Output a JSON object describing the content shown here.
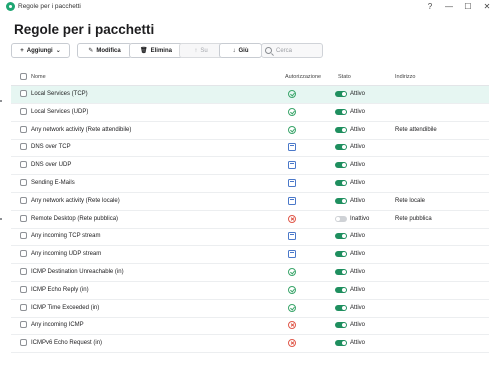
{
  "window": {
    "title": "Regole per i pacchetti",
    "help": "?",
    "minimize": "—",
    "maximize": "☐",
    "close": "✕"
  },
  "page": {
    "heading": "Regole per i pacchetti"
  },
  "toolbar": {
    "add_label": "Aggiungi",
    "edit_label": "Modifica",
    "delete_label": "Elimina",
    "up_label": "Su",
    "down_label": "Giù"
  },
  "search": {
    "placeholder": "Cerca"
  },
  "columns": {
    "name": "Nome",
    "auth": "Autorizzazione",
    "status": "Stato",
    "address": "Indirizzo"
  },
  "rows": [
    {
      "name": "Local Services (TCP)",
      "auth": "allow",
      "on": true,
      "status": "Attivo",
      "address": ""
    },
    {
      "name": "Local Services (UDP)",
      "auth": "allow",
      "on": true,
      "status": "Attivo",
      "address": ""
    },
    {
      "name": "Any network activity (Rete attendibile)",
      "auth": "allow",
      "on": true,
      "status": "Attivo",
      "address": "Rete attendibile"
    },
    {
      "name": "DNS over TCP",
      "auth": "ask",
      "on": true,
      "status": "Attivo",
      "address": ""
    },
    {
      "name": "DNS over UDP",
      "auth": "ask",
      "on": true,
      "status": "Attivo",
      "address": ""
    },
    {
      "name": "Sending E-Mails",
      "auth": "ask",
      "on": true,
      "status": "Attivo",
      "address": ""
    },
    {
      "name": "Any network activity (Rete locale)",
      "auth": "ask",
      "on": true,
      "status": "Attivo",
      "address": "Rete locale"
    },
    {
      "name": "Remote Desktop (Rete pubblica)",
      "auth": "block",
      "on": false,
      "status": "Inattivo",
      "address": "Rete pubblica"
    },
    {
      "name": "Any incoming TCP stream",
      "auth": "ask",
      "on": true,
      "status": "Attivo",
      "address": ""
    },
    {
      "name": "Any incoming UDP stream",
      "auth": "ask",
      "on": true,
      "status": "Attivo",
      "address": ""
    },
    {
      "name": "ICMP Destination Unreachable (in)",
      "auth": "allow",
      "on": true,
      "status": "Attivo",
      "address": ""
    },
    {
      "name": "ICMP Echo Reply (in)",
      "auth": "allow",
      "on": true,
      "status": "Attivo",
      "address": ""
    },
    {
      "name": "ICMP Time Exceeded (in)",
      "auth": "allow",
      "on": true,
      "status": "Attivo",
      "address": ""
    },
    {
      "name": "Any incoming ICMP",
      "auth": "block",
      "on": true,
      "status": "Attivo",
      "address": ""
    },
    {
      "name": "ICMPv6 Echo Request (in)",
      "auth": "block",
      "on": true,
      "status": "Attivo",
      "address": ""
    }
  ],
  "colors": {
    "accent": "#1f8f5f",
    "selected_row": "#e6f6f2",
    "allow": "#3aa56a",
    "block": "#e0584a",
    "ask": "#4a78c9"
  }
}
